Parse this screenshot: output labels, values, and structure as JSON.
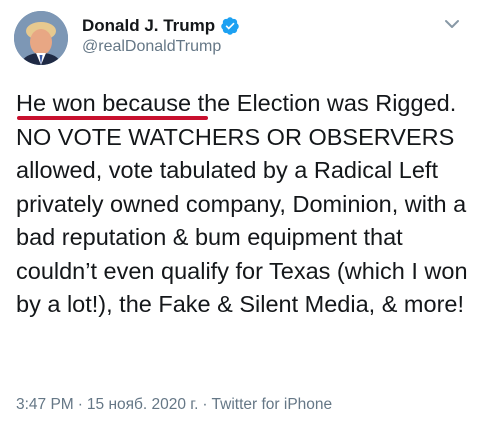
{
  "author": {
    "display_name": "Donald J. Trump",
    "handle": "@realDonaldTrump",
    "verified": true,
    "avatar_icon": "profile-photo"
  },
  "tweet": {
    "text": "He won because the Election was Rigged. NO VOTE WATCHERS OR OBSERVERS allowed, vote tabulated by a Radical Left privately owned company, Dominion, with a bad reputation & bum equipment that couldn’t even qualify for Texas (which I won by a lot!), the Fake & Silent Media, & more!",
    "highlight_color": "#c8102e"
  },
  "meta": {
    "time": "3:47 PM",
    "separator": "·",
    "date": "15 нояб. 2020 г.",
    "source": "Twitter for iPhone"
  },
  "icons": {
    "verified": "verified-badge-icon",
    "menu": "chevron-down-icon"
  },
  "colors": {
    "verified_blue": "#1da1f2",
    "text": "#14171a",
    "secondary": "#657786"
  }
}
